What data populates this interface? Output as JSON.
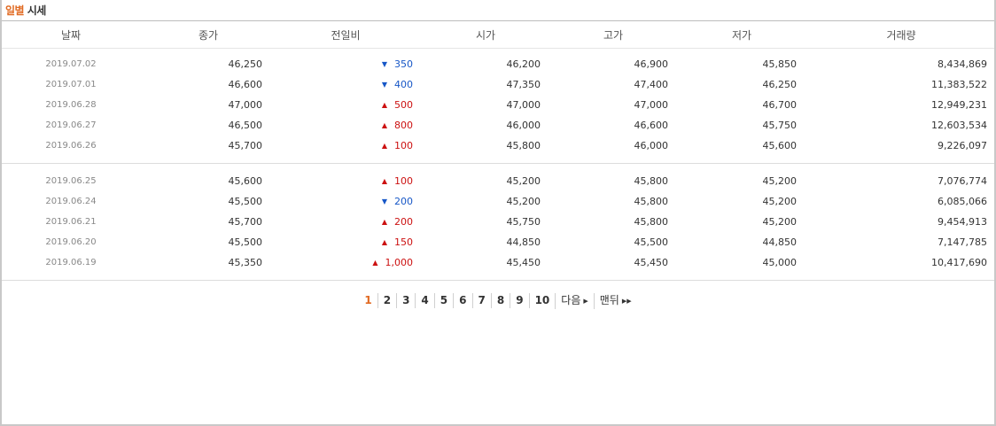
{
  "caption": {
    "highlight": "일별",
    "rest": " 시세"
  },
  "headers": [
    "날짜",
    "종가",
    "전일비",
    "시가",
    "고가",
    "저가",
    "거래량"
  ],
  "rows": [
    {
      "date": "2019.07.02",
      "close": "46,250",
      "dir": "down",
      "change": "350",
      "open": "46,200",
      "high": "46,900",
      "low": "45,850",
      "volume": "8,434,869"
    },
    {
      "date": "2019.07.01",
      "close": "46,600",
      "dir": "down",
      "change": "400",
      "open": "47,350",
      "high": "47,400",
      "low": "46,250",
      "volume": "11,383,522"
    },
    {
      "date": "2019.06.28",
      "close": "47,000",
      "dir": "up",
      "change": "500",
      "open": "47,000",
      "high": "47,000",
      "low": "46,700",
      "volume": "12,949,231"
    },
    {
      "date": "2019.06.27",
      "close": "46,500",
      "dir": "up",
      "change": "800",
      "open": "46,000",
      "high": "46,600",
      "low": "45,750",
      "volume": "12,603,534"
    },
    {
      "date": "2019.06.26",
      "close": "45,700",
      "dir": "up",
      "change": "100",
      "open": "45,800",
      "high": "46,000",
      "low": "45,600",
      "volume": "9,226,097"
    },
    {
      "date": "2019.06.25",
      "close": "45,600",
      "dir": "up",
      "change": "100",
      "open": "45,200",
      "high": "45,800",
      "low": "45,200",
      "volume": "7,076,774"
    },
    {
      "date": "2019.06.24",
      "close": "45,500",
      "dir": "down",
      "change": "200",
      "open": "45,200",
      "high": "45,800",
      "low": "45,200",
      "volume": "6,085,066"
    },
    {
      "date": "2019.06.21",
      "close": "45,700",
      "dir": "up",
      "change": "200",
      "open": "45,750",
      "high": "45,800",
      "low": "45,200",
      "volume": "9,454,913"
    },
    {
      "date": "2019.06.20",
      "close": "45,500",
      "dir": "up",
      "change": "150",
      "open": "44,850",
      "high": "45,500",
      "low": "44,850",
      "volume": "7,147,785"
    },
    {
      "date": "2019.06.19",
      "close": "45,350",
      "dir": "up",
      "change": "1,000",
      "open": "45,450",
      "high": "45,450",
      "low": "45,000",
      "volume": "10,417,690"
    }
  ],
  "colors": {
    "up": "#cc1111",
    "down": "#1757c7",
    "accent": "#e16a22"
  },
  "icons": {
    "up": "triangle-up-icon",
    "down": "triangle-down-icon"
  },
  "pagination": {
    "pages": [
      "1",
      "2",
      "3",
      "4",
      "5",
      "6",
      "7",
      "8",
      "9",
      "10"
    ],
    "current": "1",
    "next_label": "다음",
    "last_label": "맨뒤"
  }
}
